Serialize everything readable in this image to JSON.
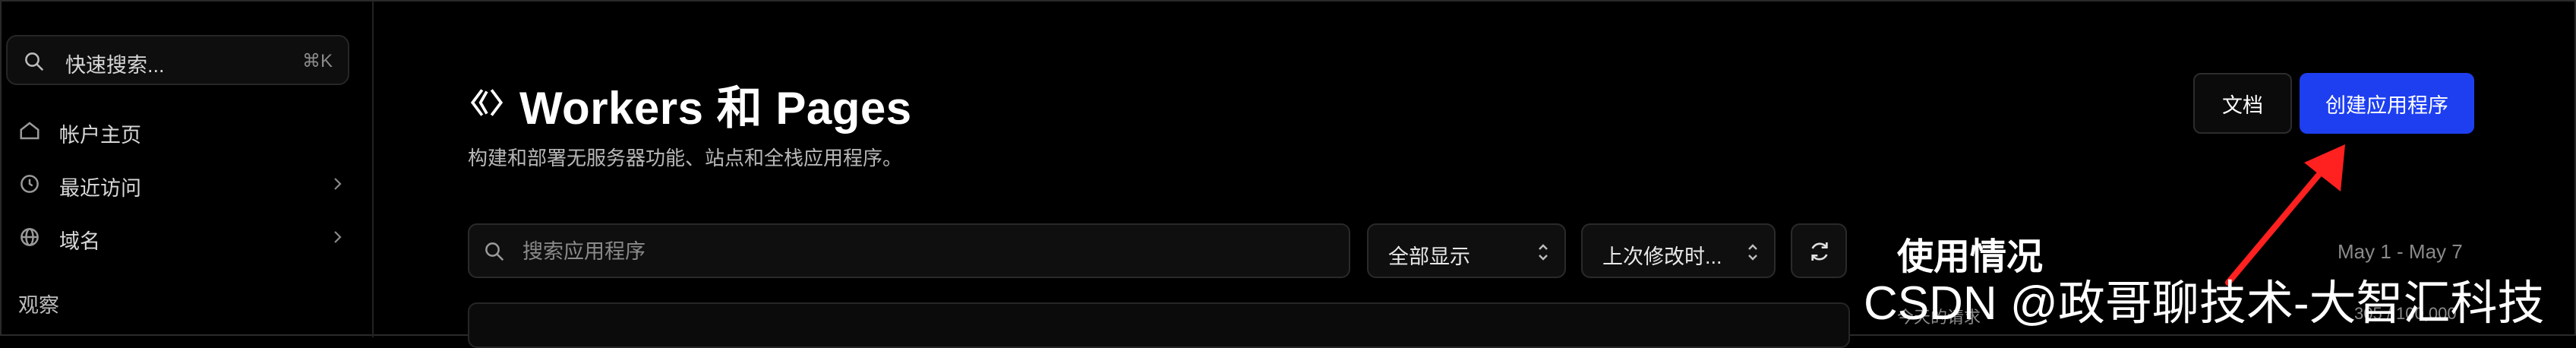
{
  "sidebar": {
    "search": {
      "label": "快速搜索...",
      "shortcut": "⌘K",
      "icon": "search-icon"
    },
    "items": [
      {
        "label": "帐户主页",
        "icon": "home-icon",
        "has_chevron": false
      },
      {
        "label": "最近访问",
        "icon": "history-icon",
        "has_chevron": true
      },
      {
        "label": "域名",
        "icon": "globe-icon",
        "has_chevron": true
      }
    ],
    "section_title": "观察"
  },
  "header": {
    "title": "Workers 和 Pages",
    "title_icon": "workers-icon",
    "description": "构建和部署无服务器功能、站点和全栈应用程序。",
    "docs_button": "文档",
    "create_button": "创建应用程序"
  },
  "toolbar": {
    "search_placeholder": "搜索应用程序",
    "filter_value": "全部显示",
    "sort_value": "上次修改时...",
    "refresh_icon": "refresh-icon"
  },
  "usage": {
    "title": "使用情况",
    "range": "May 1 - May 7",
    "subtitle": "今天的请求",
    "count": "305 / 100,000"
  },
  "watermark": "CSDN @政哥聊技术-大智汇科技",
  "colors": {
    "background": "#000000",
    "primary_button": "#1d3ff0",
    "annotation_arrow": "#ff2020"
  }
}
